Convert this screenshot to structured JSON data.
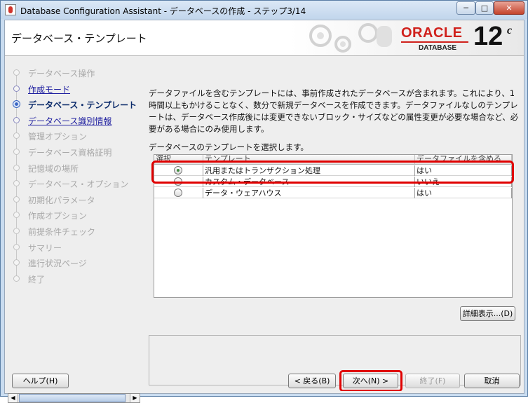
{
  "window": {
    "title": "Database Configuration Assistant - データベースの作成 - ステップ3/14",
    "minimize": "─",
    "maximize": "□",
    "close": "✕"
  },
  "header": {
    "page_title": "データベース・テンプレート",
    "logo": {
      "brand": "ORACLE",
      "sub": "DATABASE",
      "version": "12",
      "version_sup": "c"
    }
  },
  "steps": [
    {
      "label": "データベース操作",
      "state": "done-plain"
    },
    {
      "label": "作成モード",
      "state": "done"
    },
    {
      "label": "データベース・テンプレート",
      "state": "current"
    },
    {
      "label": "データベース識別情報",
      "state": "done"
    },
    {
      "label": "管理オプション",
      "state": "pending"
    },
    {
      "label": "データベース資格証明",
      "state": "pending"
    },
    {
      "label": "記憶域の場所",
      "state": "pending"
    },
    {
      "label": "データベース・オプション",
      "state": "pending"
    },
    {
      "label": "初期化パラメータ",
      "state": "pending"
    },
    {
      "label": "作成オプション",
      "state": "pending"
    },
    {
      "label": "前提条件チェック",
      "state": "pending"
    },
    {
      "label": "サマリー",
      "state": "pending"
    },
    {
      "label": "進行状況ページ",
      "state": "pending"
    },
    {
      "label": "終了",
      "state": "pending"
    }
  ],
  "main": {
    "description": "データファイルを含むテンプレートには、事前作成されたデータベースが含まれます。これにより、1時間以上もかけることなく、数分で新規データベースを作成できます。データファイルなしのテンプレートは、データベース作成後には変更できないブロック・サイズなどの属性変更が必要な場合など、必要がある場合にのみ使用します。",
    "select_prompt": "データベースのテンプレートを選択します。",
    "table": {
      "columns": [
        "選択",
        "テンプレート",
        "データファイルを含める"
      ],
      "rows": [
        {
          "selected": true,
          "template": "汎用またはトランザクション処理",
          "includes_datafiles": "はい"
        },
        {
          "selected": false,
          "template": "カスタム・データベース",
          "includes_datafiles": "いいえ"
        },
        {
          "selected": false,
          "template": "データ・ウェアハウス",
          "includes_datafiles": "はい"
        }
      ]
    },
    "details_button": "詳細表示...(D)"
  },
  "buttons": {
    "help": "ヘルプ(H)",
    "back": "< 戻る(B)",
    "next": "次へ(N) >",
    "finish": "終了(F)",
    "cancel": "取消"
  },
  "colors": {
    "highlight": "#e00000",
    "brand_red": "#d0211c",
    "current_step": "#0a2a6a"
  }
}
